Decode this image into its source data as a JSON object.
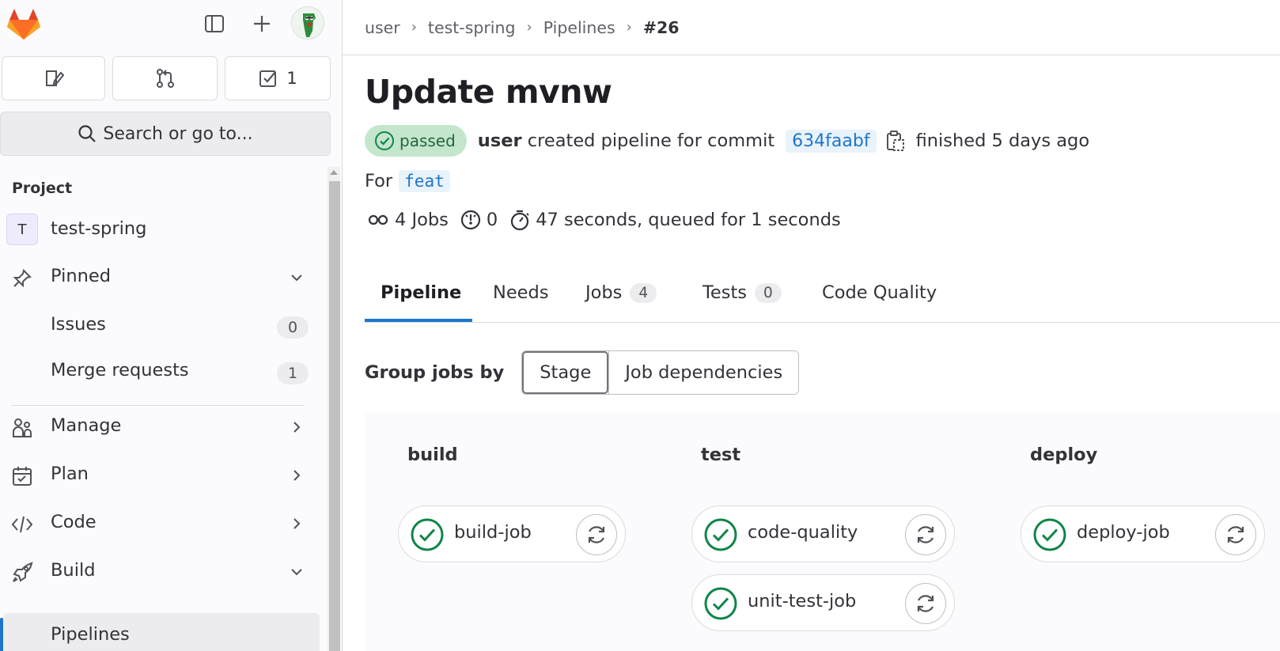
{
  "sidebar": {
    "issues_count_badge": "1",
    "search_placeholder": "Search or go to...",
    "section_title": "Project",
    "project": {
      "initial": "T",
      "name": "test-spring"
    },
    "pinned_label": "Pinned",
    "pinned_items": [
      {
        "label": "Issues",
        "count": "0"
      },
      {
        "label": "Merge requests",
        "count": "1"
      }
    ],
    "menu": [
      {
        "label": "Manage"
      },
      {
        "label": "Plan"
      },
      {
        "label": "Code"
      },
      {
        "label": "Build"
      }
    ],
    "active_item": "Pipelines"
  },
  "breadcrumb": [
    "user",
    "test-spring",
    "Pipelines",
    "#26"
  ],
  "pipeline": {
    "title": "Update mvnw",
    "status": "passed",
    "author": "user",
    "created_text": "created pipeline for commit",
    "commit_sha": "634faabf",
    "finished_text": "finished 5 days ago",
    "for_label": "For",
    "ref": "feat",
    "jobs_count": "4 Jobs",
    "compute_minutes": "0",
    "duration": "47 seconds, queued for 1 seconds"
  },
  "tabs": [
    {
      "label": "Pipeline",
      "count": null
    },
    {
      "label": "Needs",
      "count": null
    },
    {
      "label": "Jobs",
      "count": "4"
    },
    {
      "label": "Tests",
      "count": "0"
    },
    {
      "label": "Code Quality",
      "count": null
    }
  ],
  "group_by": {
    "label": "Group jobs by",
    "options": [
      "Stage",
      "Job dependencies"
    ],
    "selected": "Stage"
  },
  "stages": [
    {
      "name": "build",
      "jobs": [
        "build-job"
      ]
    },
    {
      "name": "test",
      "jobs": [
        "code-quality",
        "unit-test-job"
      ]
    },
    {
      "name": "deploy",
      "jobs": [
        "deploy-job"
      ]
    }
  ],
  "colors": {
    "success": "#108548",
    "accent": "#1f75cb",
    "badge_bg": "#c3e6cd"
  }
}
